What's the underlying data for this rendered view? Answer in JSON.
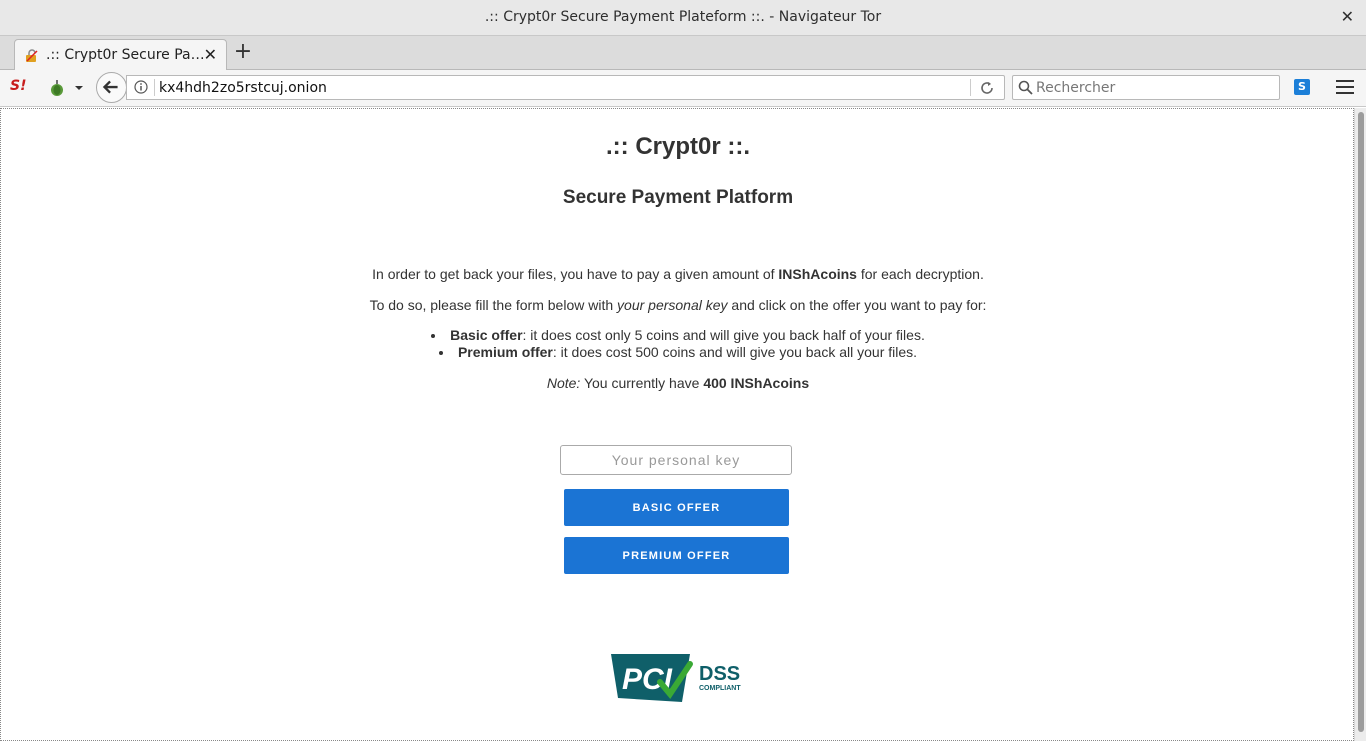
{
  "window": {
    "title": ".:: Crypt0r Secure Payment Plateform ::. - Navigateur Tor"
  },
  "tab": {
    "label": ".:: Crypt0r Secure Pa…"
  },
  "navbar": {
    "url": "kx4hdh2zo5rstcuj.onion",
    "search_placeholder": "Rechercher",
    "s_label": "S"
  },
  "page": {
    "heading": ".:: Crypt0r ::.",
    "subheading": "Secure Payment Platform",
    "intro": {
      "before": "In order to get back your files, you have to pay a given amount of ",
      "currency": "INShAcoins",
      "after": " for each decryption."
    },
    "instructions": {
      "before": "To do so, please fill the form below with ",
      "key": "your personal key",
      "after": " and click on the offer you want to pay for:"
    },
    "offers": [
      {
        "name": "Basic offer",
        "desc": ": it does cost only 5 coins and will give you back half of your files."
      },
      {
        "name": "Premium offer",
        "desc": ": it does cost 500 coins and will give you back all your files."
      }
    ],
    "note": {
      "label": "Note:",
      "text": " You currently have ",
      "balance": "400 INShAcoins"
    },
    "key_placeholder": "Your personal key",
    "basic_button": "BASIC OFFER",
    "premium_button": "PREMIUM OFFER",
    "logo": {
      "pci": "PCI",
      "dss": "DSS",
      "compliant": "COMPLIANT"
    }
  },
  "colors": {
    "button": "#1b74d4",
    "logo_teal": "#0f5f69",
    "logo_green": "#3aa935"
  }
}
